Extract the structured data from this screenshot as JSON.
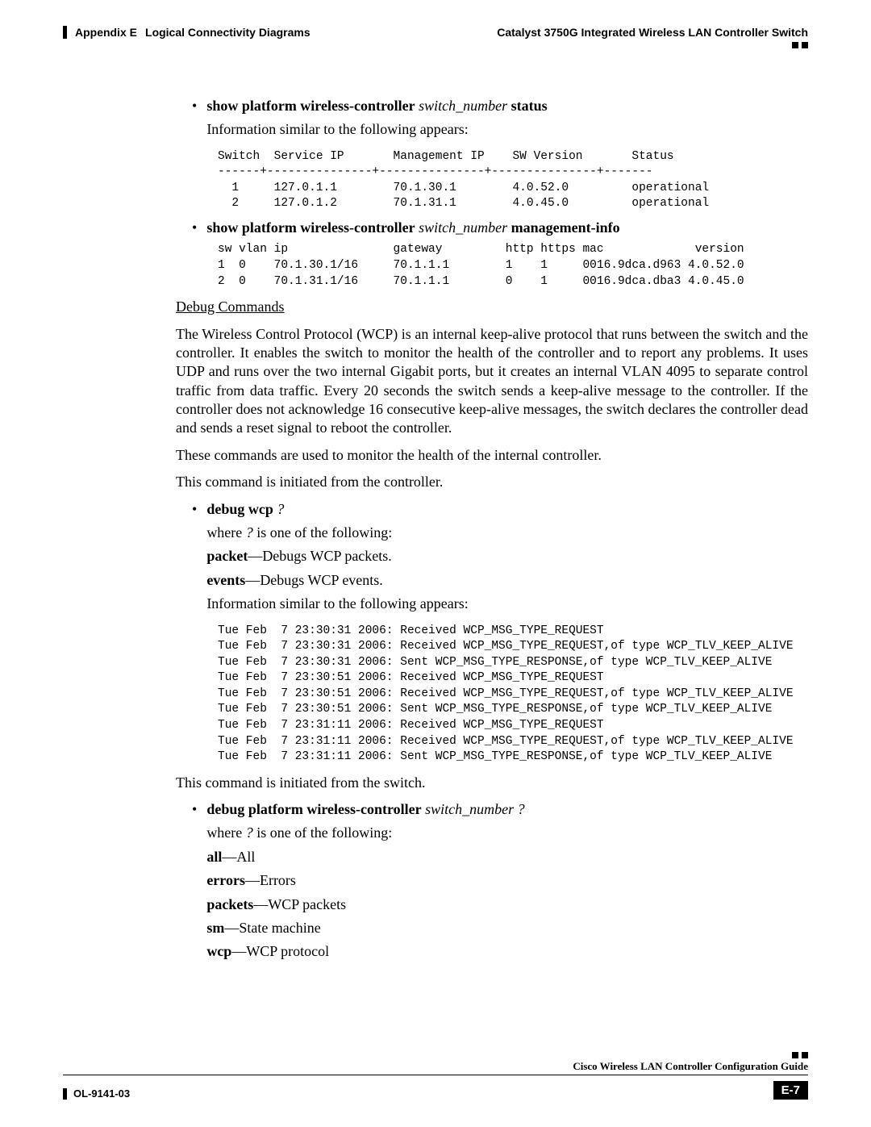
{
  "header": {
    "appendix": "Appendix E",
    "appendix_title": "Logical Connectivity Diagrams",
    "product": "Catalyst 3750G Integrated Wireless LAN Controller Switch"
  },
  "content": {
    "bullet1": {
      "cmd_pre": "show platform wireless-controller",
      "cmd_arg": "switch_number",
      "cmd_post": "status",
      "desc": "Information similar to the following appears:",
      "output": "Switch  Service IP       Management IP    SW Version       Status\n------+---------------+---------------+---------------+-------\n  1     127.0.1.1        70.1.30.1        4.0.52.0         operational\n  2     127.0.1.2        70.1.31.1        4.0.45.0         operational"
    },
    "bullet2": {
      "cmd_pre": "show platform wireless-controller",
      "cmd_arg": "switch_number",
      "cmd_post": "management-info",
      "output": "sw vlan ip               gateway         http https mac             version\n1  0    70.1.30.1/16     70.1.1.1        1    1     0016.9dca.d963 4.0.52.0\n2  0    70.1.31.1/16     70.1.1.1        0    1     0016.9dca.dba3 4.0.45.0"
    },
    "debug_heading": "Debug Commands",
    "wcp_para": "The Wireless Control Protocol (WCP) is an internal keep-alive protocol that runs between the switch and the controller. It enables the switch to monitor the health of the controller and to report any problems. It uses UDP and runs over the two internal Gigabit ports, but it creates an internal VLAN 4095 to separate control traffic from data traffic. Every 20 seconds the switch sends a keep-alive message to the controller. If the controller does not acknowledge 16 consecutive keep-alive messages, the switch declares the controller dead and sends a reset signal to reboot the controller.",
    "wcp_use": "These commands are used to monitor the health of the internal controller.",
    "cmd_from_controller": "This command is initiated from the controller.",
    "bullet3": {
      "cmd_pre": "debug wcp",
      "cmd_arg": "?",
      "where_pre": "where ",
      "where_arg": "?",
      "where_post": " is one of the following:",
      "opt1_b": "packet",
      "opt1_t": "—Debugs WCP packets.",
      "opt2_b": "events",
      "opt2_t": "—Debugs WCP events.",
      "desc": "Information similar to the following appears:",
      "output": "Tue Feb  7 23:30:31 2006: Received WCP_MSG_TYPE_REQUEST\nTue Feb  7 23:30:31 2006: Received WCP_MSG_TYPE_REQUEST,of type WCP_TLV_KEEP_ALIVE\nTue Feb  7 23:30:31 2006: Sent WCP_MSG_TYPE_RESPONSE,of type WCP_TLV_KEEP_ALIVE\nTue Feb  7 23:30:51 2006: Received WCP_MSG_TYPE_REQUEST\nTue Feb  7 23:30:51 2006: Received WCP_MSG_TYPE_REQUEST,of type WCP_TLV_KEEP_ALIVE\nTue Feb  7 23:30:51 2006: Sent WCP_MSG_TYPE_RESPONSE,of type WCP_TLV_KEEP_ALIVE\nTue Feb  7 23:31:11 2006: Received WCP_MSG_TYPE_REQUEST\nTue Feb  7 23:31:11 2006: Received WCP_MSG_TYPE_REQUEST,of type WCP_TLV_KEEP_ALIVE\nTue Feb  7 23:31:11 2006: Sent WCP_MSG_TYPE_RESPONSE,of type WCP_TLV_KEEP_ALIVE"
    },
    "cmd_from_switch": "This command is initiated from the switch.",
    "bullet4": {
      "cmd_pre": "debug platform wireless-controller",
      "cmd_arg": "switch_number ?",
      "where_pre": "where ",
      "where_arg": "?",
      "where_post": " is one of the following:",
      "opts": {
        "all_b": "all",
        "all_t": "—All",
        "err_b": "errors",
        "err_t": "—Errors",
        "pkt_b": "packets",
        "pkt_t": "—WCP packets",
        "sm_b": "sm",
        "sm_t": "—State machine",
        "wcp_b": "wcp",
        "wcp_t": "—WCP protocol"
      }
    }
  },
  "footer": {
    "doc_id": "OL-9141-03",
    "guide": "Cisco Wireless LAN Controller Configuration Guide",
    "page": "E-7"
  }
}
